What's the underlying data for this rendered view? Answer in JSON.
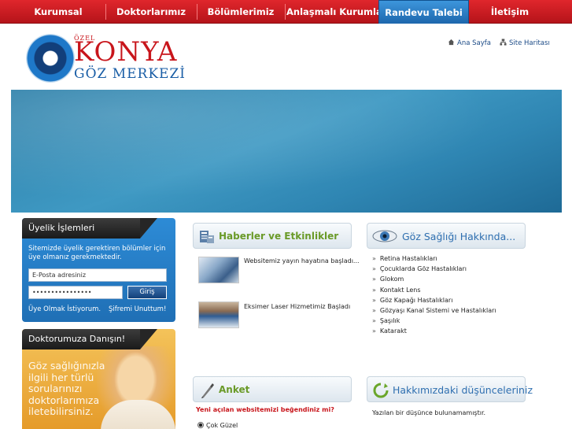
{
  "nav": {
    "items": [
      "Kurumsal",
      "Doktorlarımız",
      "Bölümlerimiz",
      "Anlaşmalı Kurumlar",
      "Randevu Talebi",
      "İletişim"
    ],
    "active": "Randevu Talebi"
  },
  "header": {
    "logo": {
      "ozel": "ÖZEL",
      "konya": "KONYA",
      "goz": "GÖZ MERKEZİ"
    },
    "links": {
      "home": "Ana Sayfa",
      "sitemap": "Site Haritası"
    }
  },
  "uyelik": {
    "title": "Üyelik İşlemleri",
    "info": "Sitemizde üyelik gerektiren bölümler için üye olmanız gerekmektedir.",
    "email_value": "E-Posta adresiniz",
    "password_value": "••••••••••••••••",
    "login_label": "Giriş",
    "register_link": "Üye Olmak İstiyorum.",
    "forgot_link": "Şifremi Unuttum!"
  },
  "doktor": {
    "title": "Doktorumuza Danışın!",
    "text": "Göz sağlığınızla ilgili her türlü sorularınızı doktorlarımıza iletebilirsiniz."
  },
  "haberler": {
    "title": "Haberler ve Etkinlikler",
    "items": [
      {
        "text": "Websitemiz yayın hayatına başladı..."
      },
      {
        "text": "Eksimer Laser Hizmetimiz Başladı"
      }
    ]
  },
  "goz": {
    "title": "Göz Sağlığı Hakkında...",
    "items": [
      "Retina Hastalıkları",
      "Çocuklarda Göz Hastalıkları",
      "Glokom",
      "Kontakt Lens",
      "Göz Kapağı Hastalıkları",
      "Gözyaşı Kanal Sistemi ve Hastalıkları",
      "Şaşılık",
      "Katarakt"
    ]
  },
  "anket": {
    "title": "Anket",
    "question": "Yeni açılan websitemizi beğendiniz mi?",
    "option1": "Çok Güzel"
  },
  "hakkimizda": {
    "title": "Hakkımızdaki düşünceleriniz",
    "empty_text": "Yazılan bir düşünce bulunamamıştır."
  },
  "colors": {
    "nav_red": "#d41f25",
    "active_blue": "#2a7cc6",
    "brand_red": "#c8151b",
    "brand_blue": "#1a5ea6",
    "section_green": "#6a9a28"
  }
}
